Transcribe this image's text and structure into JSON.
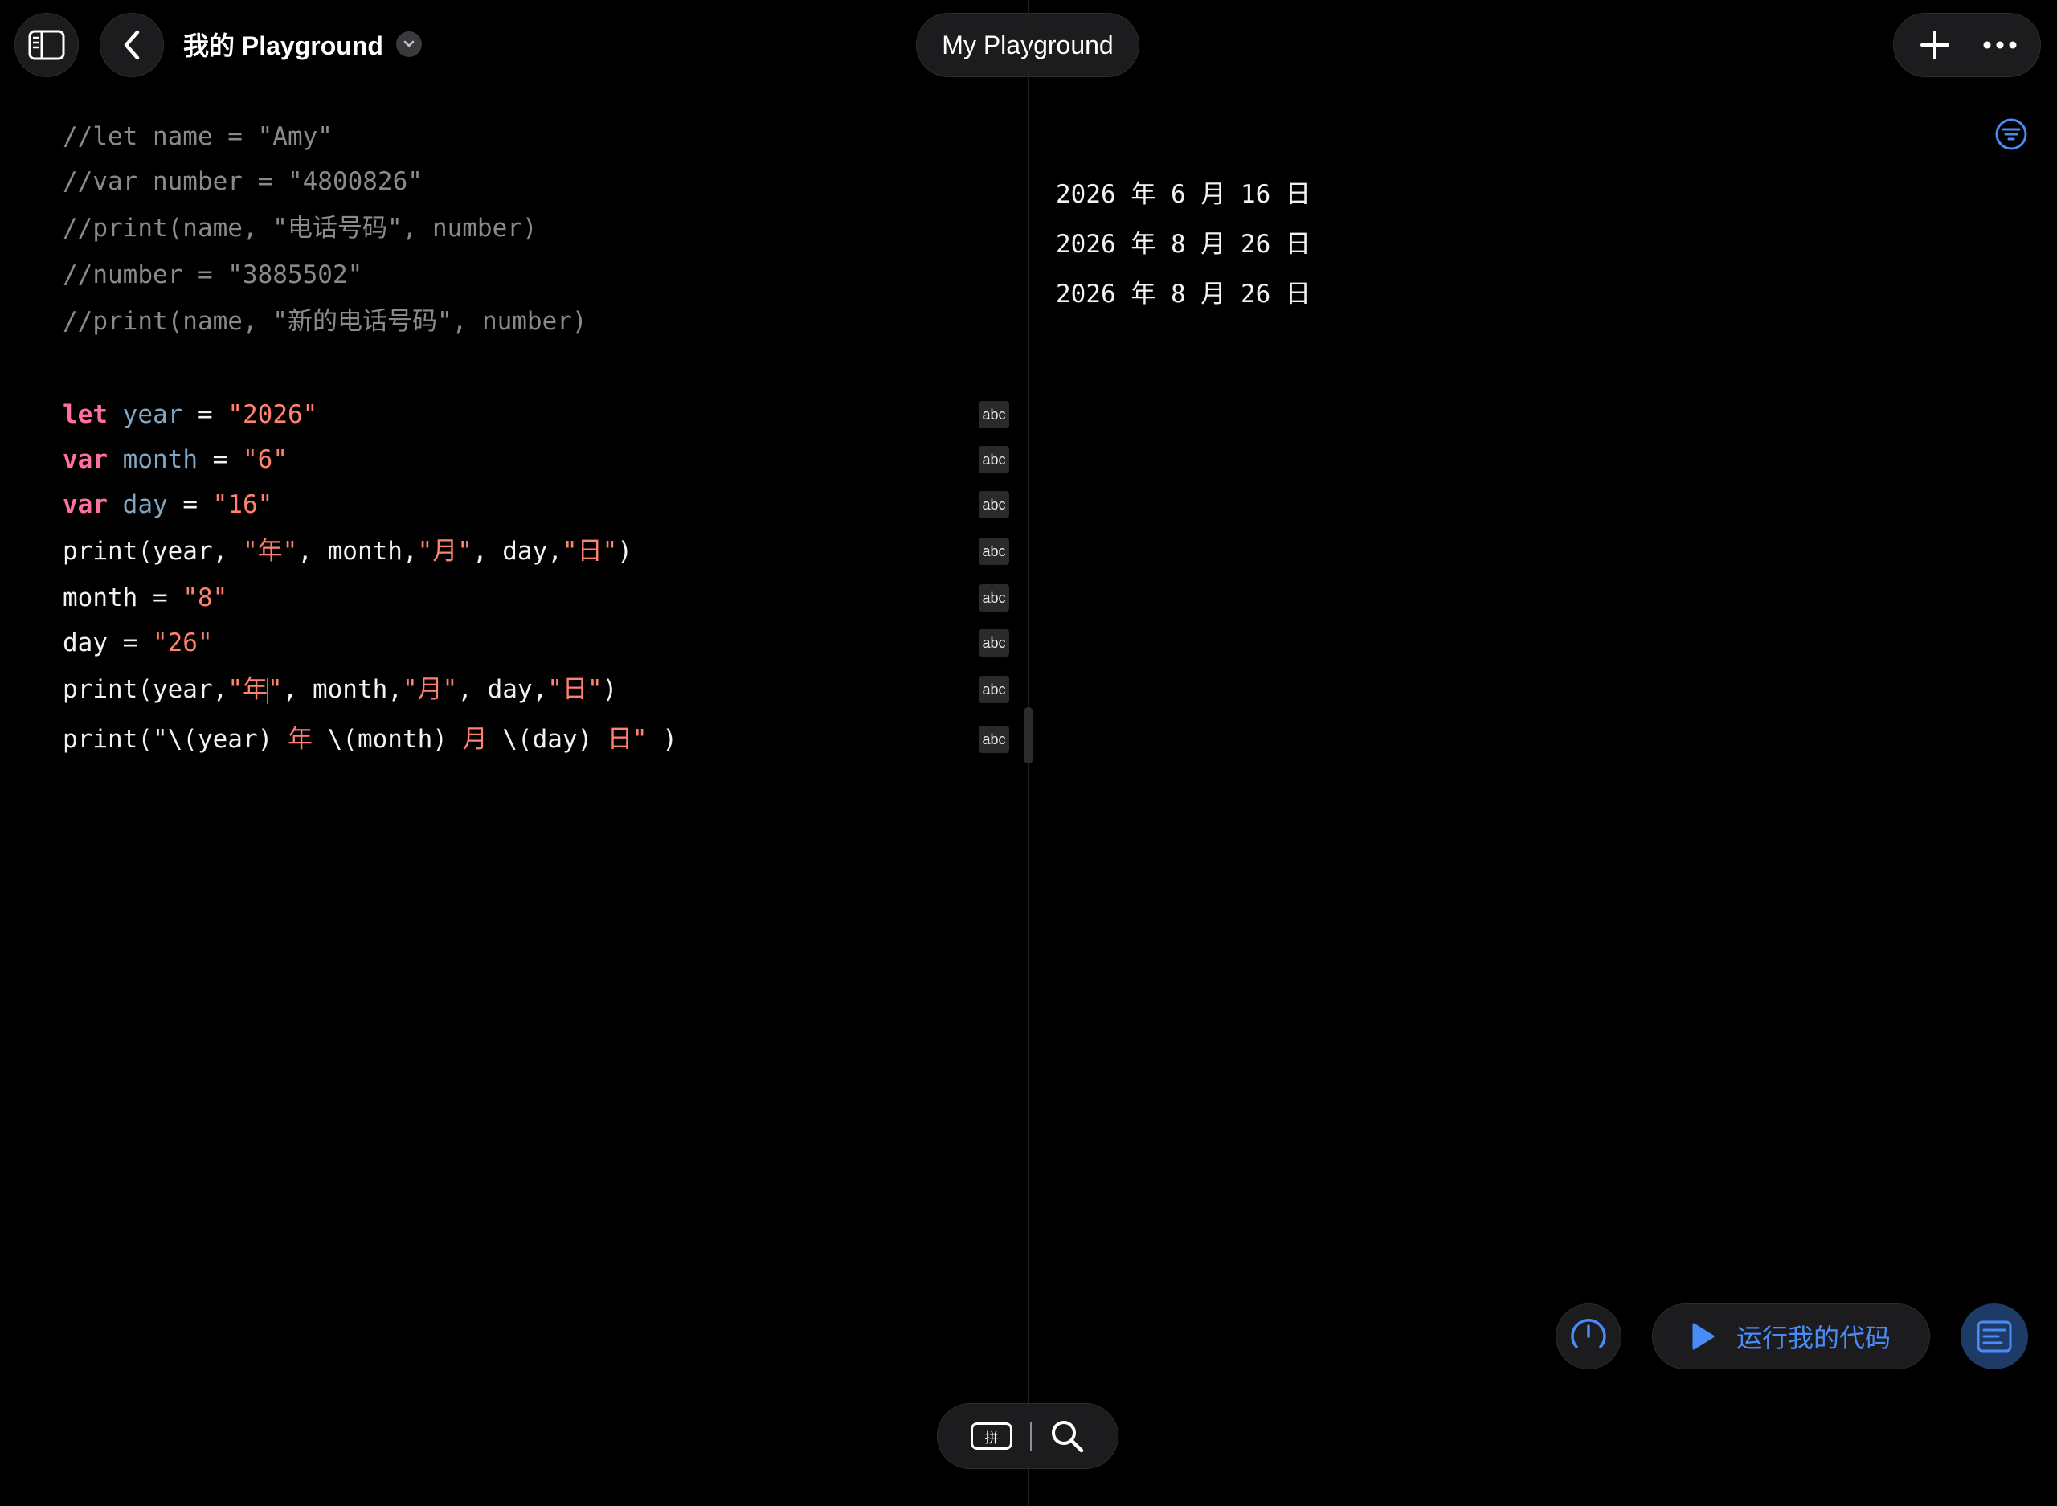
{
  "header": {
    "sidebar_icon": "sidebar-icon",
    "back_icon": "chevron-left-icon",
    "title": "我的 Playground",
    "title_menu_icon": "chevron-down-icon",
    "center_title": "My Playground",
    "add_icon": "plus-icon",
    "more_icon": "ellipsis-icon"
  },
  "editor": {
    "lines": [
      [
        {
          "t": "//let name = \"Amy\"",
          "c": "comment"
        }
      ],
      [
        {
          "t": "//var number = \"4800826\"",
          "c": "comment"
        }
      ],
      [
        {
          "t": "//print(name, \"电话号码\", number)",
          "c": "comment"
        }
      ],
      [
        {
          "t": "//number = \"3885502\"",
          "c": "comment"
        }
      ],
      [
        {
          "t": "//print(name, \"新的电话号码\", number)",
          "c": "comment"
        }
      ],
      [
        {
          "t": "let",
          "c": "kw"
        },
        {
          "t": " ",
          "c": "plain"
        },
        {
          "t": "year",
          "c": "var"
        },
        {
          "t": " = ",
          "c": "plain"
        },
        {
          "t": "\"2026\"",
          "c": "str"
        }
      ],
      [
        {
          "t": "var",
          "c": "kw"
        },
        {
          "t": " ",
          "c": "plain"
        },
        {
          "t": "month",
          "c": "var"
        },
        {
          "t": " = ",
          "c": "plain"
        },
        {
          "t": "\"6\"",
          "c": "str"
        }
      ],
      [
        {
          "t": "var",
          "c": "kw"
        },
        {
          "t": " ",
          "c": "plain"
        },
        {
          "t": "day",
          "c": "var"
        },
        {
          "t": " = ",
          "c": "plain"
        },
        {
          "t": "\"16\"",
          "c": "str"
        }
      ],
      [
        {
          "t": "print(year, ",
          "c": "plain"
        },
        {
          "t": "\"年\"",
          "c": "str"
        },
        {
          "t": ", month,",
          "c": "plain"
        },
        {
          "t": "\"月\"",
          "c": "str"
        },
        {
          "t": ", day,",
          "c": "plain"
        },
        {
          "t": "\"日\"",
          "c": "str"
        },
        {
          "t": ")",
          "c": "plain"
        }
      ],
      [
        {
          "t": "month = ",
          "c": "plain"
        },
        {
          "t": "\"8\"",
          "c": "str"
        }
      ],
      [
        {
          "t": "day = ",
          "c": "plain"
        },
        {
          "t": "\"26\"",
          "c": "str"
        }
      ],
      [
        {
          "t": "print(year,",
          "c": "plain"
        },
        {
          "t": "\"年",
          "c": "str"
        },
        {
          "t": "",
          "c": "cursor"
        },
        {
          "t": "\"",
          "c": "str"
        },
        {
          "t": ", month,",
          "c": "plain"
        },
        {
          "t": "\"月\"",
          "c": "str"
        },
        {
          "t": ", day,",
          "c": "plain"
        },
        {
          "t": "\"日\"",
          "c": "str"
        },
        {
          "t": ")",
          "c": "plain"
        }
      ],
      [
        {
          "t": "print(\"\\(year) ",
          "c": "plain"
        },
        {
          "t": "年",
          "c": "str"
        },
        {
          "t": " \\(month) ",
          "c": "plain"
        },
        {
          "t": "月",
          "c": "str"
        },
        {
          "t": " \\(day) ",
          "c": "plain"
        },
        {
          "t": "日\"",
          "c": "str"
        },
        {
          "t": " )",
          "c": "plain"
        }
      ]
    ],
    "result_badge": "abc"
  },
  "output": {
    "filter_icon": "filter-icon",
    "lines": [
      "2026 年 6 月 16 日",
      "2026 年 8 月 26 日",
      "2026 年 8 月 26 日"
    ]
  },
  "controls": {
    "gauge_icon": "speedometer-icon",
    "run_label": "运行我的代码",
    "run_icon": "play-icon",
    "console_icon": "console-icon",
    "keyboard_key_label": "拼",
    "search_icon": "search-icon"
  },
  "colors": {
    "background": "#000000",
    "accent": "#4a8cf7",
    "keyword": "#ff6fa3",
    "string": "#ff8170",
    "variable": "#7fa8c6",
    "comment": "#8a8a8e"
  }
}
